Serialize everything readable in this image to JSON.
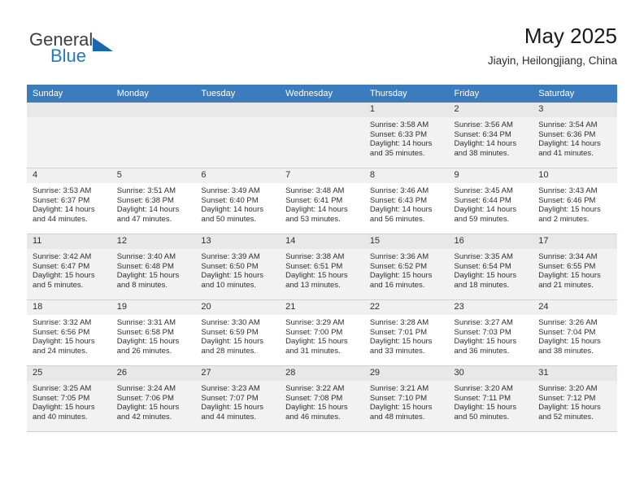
{
  "brand": {
    "name_part1": "General",
    "name_part2": "Blue",
    "triangle_color": "#1668b0",
    "blue_color": "#1e7bc4"
  },
  "header": {
    "title": "May 2025",
    "subtitle": "Jiayin, Heilongjiang, China"
  },
  "calendar": {
    "header_background": "#3a7cbe",
    "weekdays": [
      "Sunday",
      "Monday",
      "Tuesday",
      "Wednesday",
      "Thursday",
      "Friday",
      "Saturday"
    ],
    "weeks": [
      [
        {
          "day": "",
          "sunrise": "",
          "sunset": "",
          "daylight": "",
          "empty": true
        },
        {
          "day": "",
          "sunrise": "",
          "sunset": "",
          "daylight": "",
          "empty": true
        },
        {
          "day": "",
          "sunrise": "",
          "sunset": "",
          "daylight": "",
          "empty": true
        },
        {
          "day": "",
          "sunrise": "",
          "sunset": "",
          "daylight": "",
          "empty": true
        },
        {
          "day": "1",
          "sunrise": "Sunrise: 3:58 AM",
          "sunset": "Sunset: 6:33 PM",
          "daylight": "Daylight: 14 hours and 35 minutes."
        },
        {
          "day": "2",
          "sunrise": "Sunrise: 3:56 AM",
          "sunset": "Sunset: 6:34 PM",
          "daylight": "Daylight: 14 hours and 38 minutes."
        },
        {
          "day": "3",
          "sunrise": "Sunrise: 3:54 AM",
          "sunset": "Sunset: 6:36 PM",
          "daylight": "Daylight: 14 hours and 41 minutes."
        }
      ],
      [
        {
          "day": "4",
          "sunrise": "Sunrise: 3:53 AM",
          "sunset": "Sunset: 6:37 PM",
          "daylight": "Daylight: 14 hours and 44 minutes."
        },
        {
          "day": "5",
          "sunrise": "Sunrise: 3:51 AM",
          "sunset": "Sunset: 6:38 PM",
          "daylight": "Daylight: 14 hours and 47 minutes."
        },
        {
          "day": "6",
          "sunrise": "Sunrise: 3:49 AM",
          "sunset": "Sunset: 6:40 PM",
          "daylight": "Daylight: 14 hours and 50 minutes."
        },
        {
          "day": "7",
          "sunrise": "Sunrise: 3:48 AM",
          "sunset": "Sunset: 6:41 PM",
          "daylight": "Daylight: 14 hours and 53 minutes."
        },
        {
          "day": "8",
          "sunrise": "Sunrise: 3:46 AM",
          "sunset": "Sunset: 6:43 PM",
          "daylight": "Daylight: 14 hours and 56 minutes."
        },
        {
          "day": "9",
          "sunrise": "Sunrise: 3:45 AM",
          "sunset": "Sunset: 6:44 PM",
          "daylight": "Daylight: 14 hours and 59 minutes."
        },
        {
          "day": "10",
          "sunrise": "Sunrise: 3:43 AM",
          "sunset": "Sunset: 6:46 PM",
          "daylight": "Daylight: 15 hours and 2 minutes."
        }
      ],
      [
        {
          "day": "11",
          "sunrise": "Sunrise: 3:42 AM",
          "sunset": "Sunset: 6:47 PM",
          "daylight": "Daylight: 15 hours and 5 minutes."
        },
        {
          "day": "12",
          "sunrise": "Sunrise: 3:40 AM",
          "sunset": "Sunset: 6:48 PM",
          "daylight": "Daylight: 15 hours and 8 minutes."
        },
        {
          "day": "13",
          "sunrise": "Sunrise: 3:39 AM",
          "sunset": "Sunset: 6:50 PM",
          "daylight": "Daylight: 15 hours and 10 minutes."
        },
        {
          "day": "14",
          "sunrise": "Sunrise: 3:38 AM",
          "sunset": "Sunset: 6:51 PM",
          "daylight": "Daylight: 15 hours and 13 minutes."
        },
        {
          "day": "15",
          "sunrise": "Sunrise: 3:36 AM",
          "sunset": "Sunset: 6:52 PM",
          "daylight": "Daylight: 15 hours and 16 minutes."
        },
        {
          "day": "16",
          "sunrise": "Sunrise: 3:35 AM",
          "sunset": "Sunset: 6:54 PM",
          "daylight": "Daylight: 15 hours and 18 minutes."
        },
        {
          "day": "17",
          "sunrise": "Sunrise: 3:34 AM",
          "sunset": "Sunset: 6:55 PM",
          "daylight": "Daylight: 15 hours and 21 minutes."
        }
      ],
      [
        {
          "day": "18",
          "sunrise": "Sunrise: 3:32 AM",
          "sunset": "Sunset: 6:56 PM",
          "daylight": "Daylight: 15 hours and 24 minutes."
        },
        {
          "day": "19",
          "sunrise": "Sunrise: 3:31 AM",
          "sunset": "Sunset: 6:58 PM",
          "daylight": "Daylight: 15 hours and 26 minutes."
        },
        {
          "day": "20",
          "sunrise": "Sunrise: 3:30 AM",
          "sunset": "Sunset: 6:59 PM",
          "daylight": "Daylight: 15 hours and 28 minutes."
        },
        {
          "day": "21",
          "sunrise": "Sunrise: 3:29 AM",
          "sunset": "Sunset: 7:00 PM",
          "daylight": "Daylight: 15 hours and 31 minutes."
        },
        {
          "day": "22",
          "sunrise": "Sunrise: 3:28 AM",
          "sunset": "Sunset: 7:01 PM",
          "daylight": "Daylight: 15 hours and 33 minutes."
        },
        {
          "day": "23",
          "sunrise": "Sunrise: 3:27 AM",
          "sunset": "Sunset: 7:03 PM",
          "daylight": "Daylight: 15 hours and 36 minutes."
        },
        {
          "day": "24",
          "sunrise": "Sunrise: 3:26 AM",
          "sunset": "Sunset: 7:04 PM",
          "daylight": "Daylight: 15 hours and 38 minutes."
        }
      ],
      [
        {
          "day": "25",
          "sunrise": "Sunrise: 3:25 AM",
          "sunset": "Sunset: 7:05 PM",
          "daylight": "Daylight: 15 hours and 40 minutes."
        },
        {
          "day": "26",
          "sunrise": "Sunrise: 3:24 AM",
          "sunset": "Sunset: 7:06 PM",
          "daylight": "Daylight: 15 hours and 42 minutes."
        },
        {
          "day": "27",
          "sunrise": "Sunrise: 3:23 AM",
          "sunset": "Sunset: 7:07 PM",
          "daylight": "Daylight: 15 hours and 44 minutes."
        },
        {
          "day": "28",
          "sunrise": "Sunrise: 3:22 AM",
          "sunset": "Sunset: 7:08 PM",
          "daylight": "Daylight: 15 hours and 46 minutes."
        },
        {
          "day": "29",
          "sunrise": "Sunrise: 3:21 AM",
          "sunset": "Sunset: 7:10 PM",
          "daylight": "Daylight: 15 hours and 48 minutes."
        },
        {
          "day": "30",
          "sunrise": "Sunrise: 3:20 AM",
          "sunset": "Sunset: 7:11 PM",
          "daylight": "Daylight: 15 hours and 50 minutes."
        },
        {
          "day": "31",
          "sunrise": "Sunrise: 3:20 AM",
          "sunset": "Sunset: 7:12 PM",
          "daylight": "Daylight: 15 hours and 52 minutes."
        }
      ]
    ]
  }
}
